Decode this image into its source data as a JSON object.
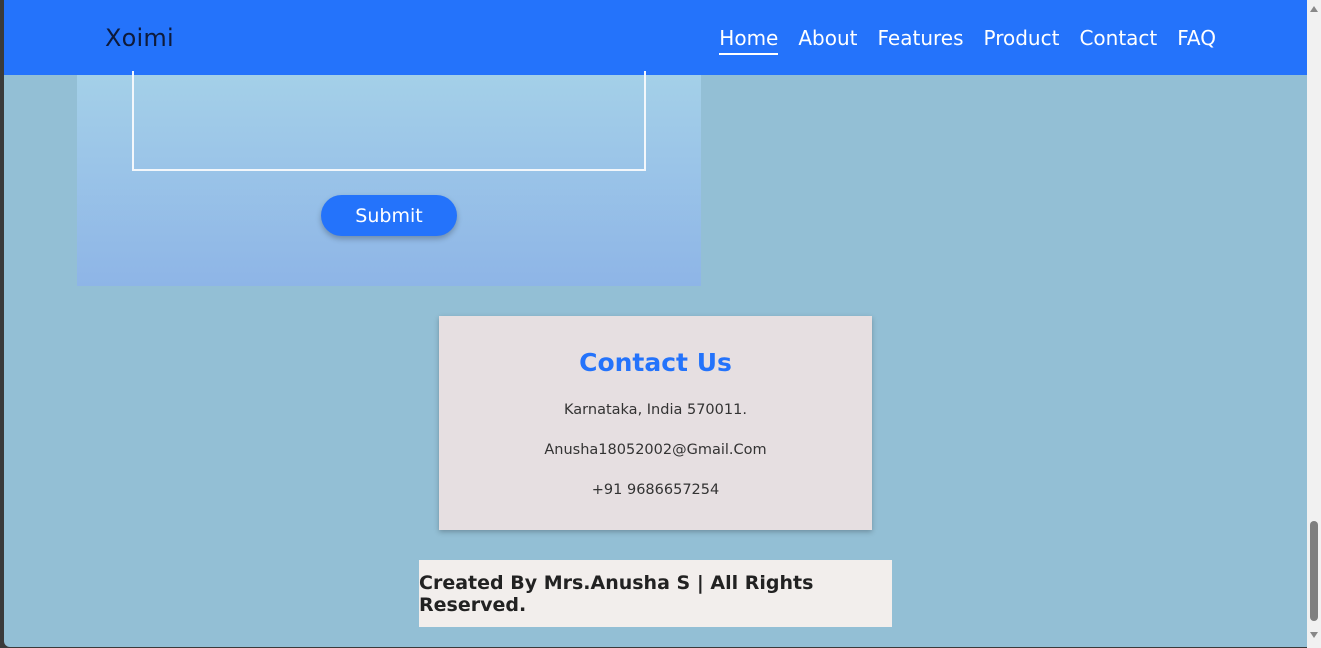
{
  "navbar": {
    "brand": "Xoimi",
    "links": [
      {
        "label": "Home",
        "active": true
      },
      {
        "label": "About"
      },
      {
        "label": "Features"
      },
      {
        "label": "Product"
      },
      {
        "label": "Contact"
      },
      {
        "label": "FAQ"
      }
    ],
    "color": "#2473fb"
  },
  "form": {
    "message_value": "",
    "submit_label": "Submit"
  },
  "contact": {
    "title": "Contact Us",
    "address": "Karnataka, India 570011.",
    "email": "Anusha18052002@Gmail.Com",
    "phone": "+91 9686657254"
  },
  "footer": {
    "text": "Created By Mrs.Anusha S | All Rights Reserved."
  },
  "colors": {
    "page_bg": "#93bfd5",
    "accent": "#2473fb",
    "card_bg": "#e6dfe1",
    "footer_bg": "#f2eeec"
  }
}
